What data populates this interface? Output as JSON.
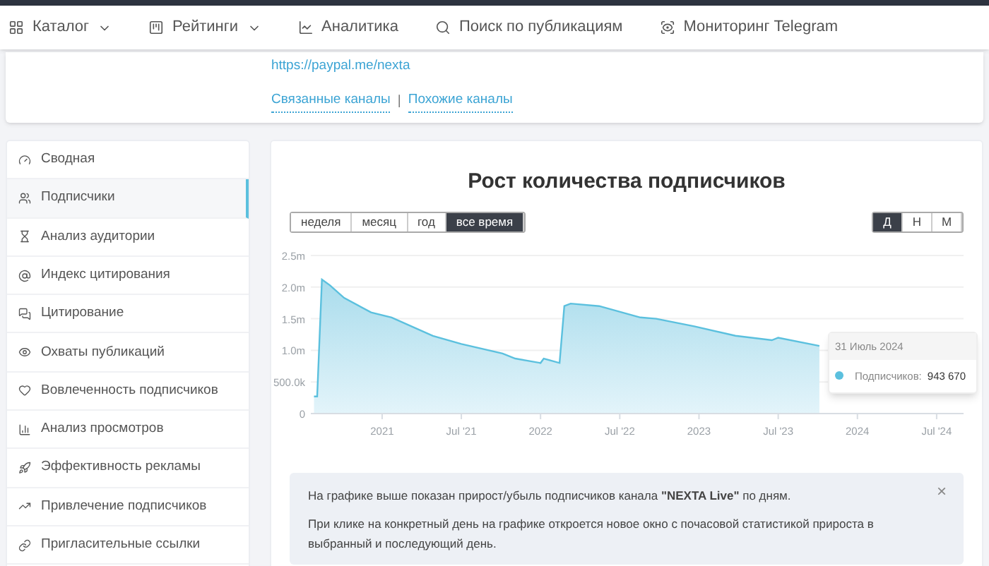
{
  "nav": [
    {
      "label": "Каталог",
      "dropdown": true
    },
    {
      "label": "Рейтинги",
      "dropdown": true
    },
    {
      "label": "Аналитика",
      "dropdown": false
    },
    {
      "label": "Поиск по публикациям",
      "dropdown": false
    },
    {
      "label": "Мониторинг Telegram",
      "dropdown": false
    }
  ],
  "channel_card": {
    "link": "https://paypal.me/nexta",
    "related_links": [
      "Связанные каналы",
      "Похожие каналы"
    ],
    "separator": "|"
  },
  "sidebar": {
    "items": [
      {
        "label": "Сводная",
        "selected": false
      },
      {
        "label": "Подписчики",
        "selected": true
      },
      {
        "label": "Анализ аудитории",
        "selected": false
      },
      {
        "label": "Индекс цитирования",
        "selected": false
      },
      {
        "label": "Цитирование",
        "selected": false
      },
      {
        "label": "Охваты публикаций",
        "selected": false
      },
      {
        "label": "Вовлеченность подписчиков",
        "selected": false
      },
      {
        "label": "Анализ просмотров",
        "selected": false
      },
      {
        "label": "Эффективность рекламы",
        "selected": false
      },
      {
        "label": "Привлечение подписчиков",
        "selected": false
      },
      {
        "label": "Пригласительные ссылки",
        "selected": false
      }
    ]
  },
  "panel": {
    "title": "Рост количества подписчиков",
    "periods": [
      {
        "label": "неделя",
        "selected": false
      },
      {
        "label": "месяц",
        "selected": false
      },
      {
        "label": "год",
        "selected": false
      },
      {
        "label": "все время",
        "selected": true
      }
    ],
    "granularity": [
      {
        "label": "Д",
        "selected": true
      },
      {
        "label": "Н",
        "selected": false
      },
      {
        "label": "М",
        "selected": false
      }
    ],
    "chart_data": {
      "type": "area",
      "grid": true,
      "x": [
        2020.57,
        2020.59,
        2020.62,
        2020.67,
        2020.76,
        2020.93,
        2021.06,
        2021.32,
        2021.5,
        2021.76,
        2021.84,
        2022.0,
        2022.02,
        2022.12,
        2022.15,
        2022.19,
        2022.37,
        2022.63,
        2022.73,
        2022.97,
        2023.23,
        2023.46,
        2023.5,
        2023.76
      ],
      "series": [
        {
          "color": "#5bc0de",
          "values": [
            270000,
            270000,
            2120000,
            2030000,
            1830000,
            1600000,
            1520000,
            1230000,
            1100000,
            950000,
            870000,
            800000,
            870000,
            800000,
            1700000,
            1740000,
            1700000,
            1520000,
            1500000,
            1380000,
            1230000,
            1160000,
            1200000,
            1070000
          ]
        }
      ],
      "xlim": [
        2020.55,
        2024.67
      ],
      "ylim": [
        0,
        2500000
      ],
      "xticks": [
        {
          "value": 2021,
          "label": "2021"
        },
        {
          "value": 2021.5,
          "label": "Jul '21"
        },
        {
          "value": 2022,
          "label": "2022"
        },
        {
          "value": 2022.5,
          "label": "Jul '22"
        },
        {
          "value": 2023,
          "label": "2023"
        },
        {
          "value": 2023.5,
          "label": "Jul '23"
        },
        {
          "value": 2024,
          "label": "2024"
        },
        {
          "value": 2024.5,
          "label": "Jul '24"
        }
      ],
      "yticks": [
        {
          "value": 0,
          "label": "0"
        },
        {
          "value": 500000,
          "label": "500.0k"
        },
        {
          "value": 1000000,
          "label": "1.0m"
        },
        {
          "value": 1500000,
          "label": "1.5m"
        },
        {
          "value": 2000000,
          "label": "2.0m"
        },
        {
          "value": 2500000,
          "label": "2.5m"
        }
      ]
    },
    "tooltip": {
      "date": "31 Июль 2024",
      "label": "Подписчиков:",
      "value": "943 670"
    },
    "info": {
      "lines": [
        "На графике выше показан прирост/убыль подписчиков канала **\"NEXTA Live\"** по дням.",
        "При клике на конкретный день на графике откроется новое окно с почасовой статистикой прироста в выбранный и последующий день."
      ],
      "close": "×"
    }
  }
}
